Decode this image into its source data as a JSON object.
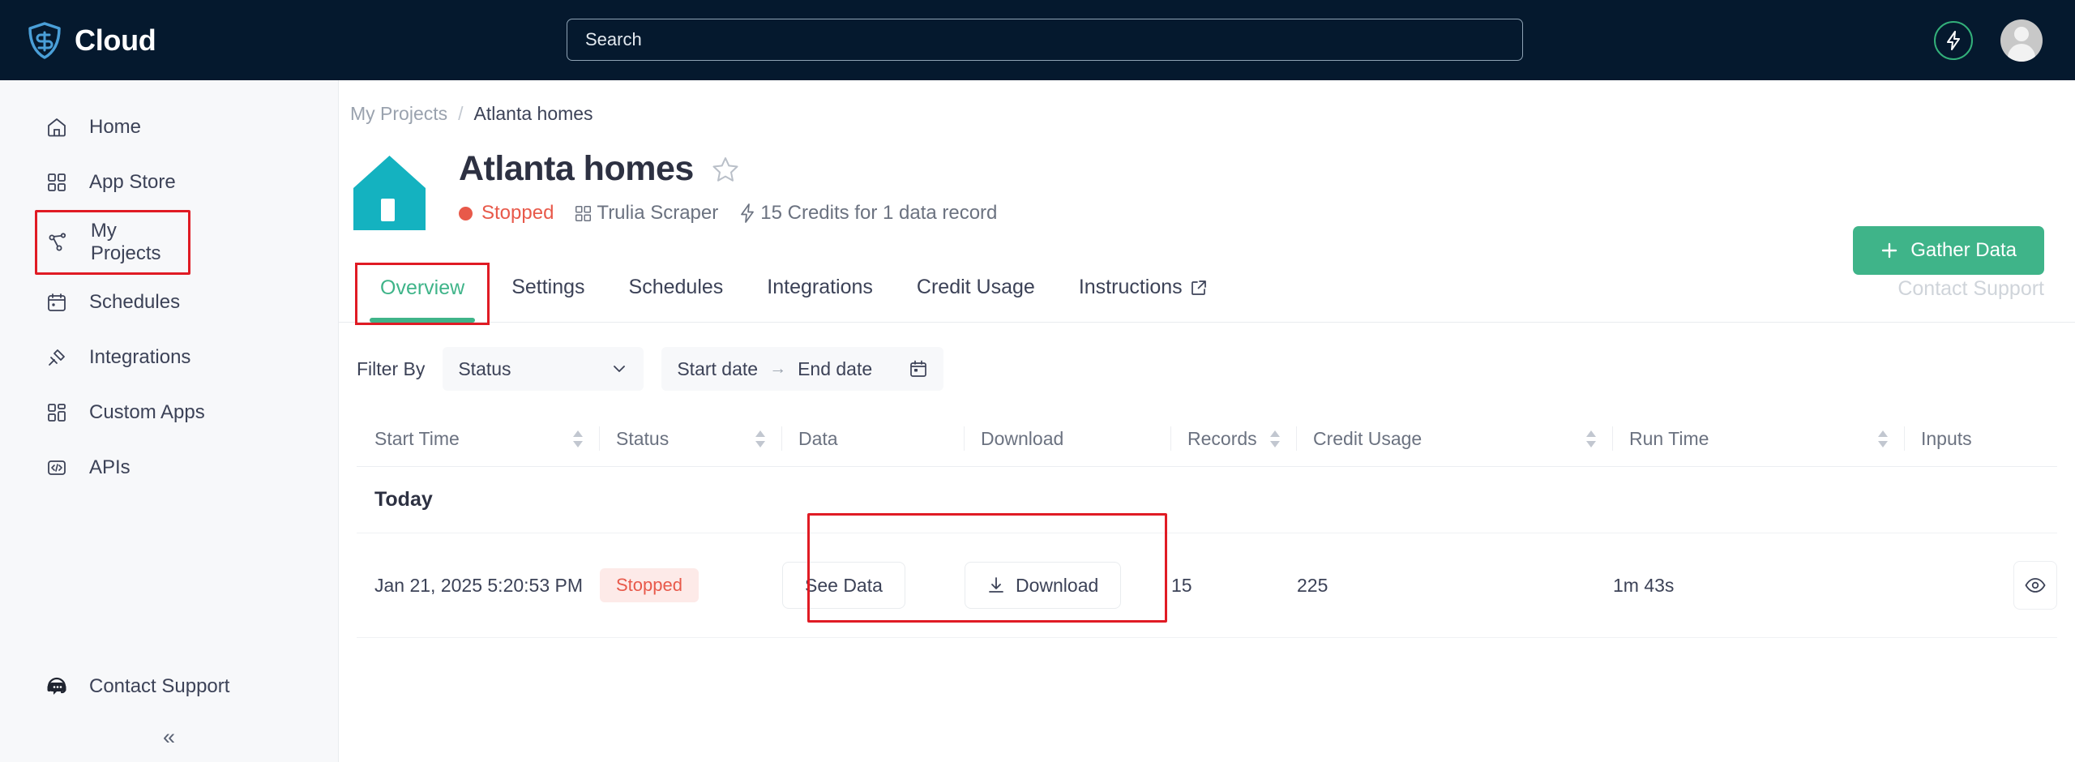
{
  "colors": {
    "topbar_bg": "#05192e",
    "accent_green": "#3fb489",
    "status_red": "#e8594a",
    "annotation_red": "#e01b24",
    "house_teal": "#14b2c0",
    "sidebar_bg": "#f7f8fa"
  },
  "topbar": {
    "brand_name": "Cloud",
    "logo_icon": "shield-logo-icon",
    "search_placeholder": "Search",
    "search_value": "",
    "credits_icon": "lightning-bolt-icon",
    "avatar_icon": "user-avatar-icon"
  },
  "sidebar": {
    "items": [
      {
        "label": "Home",
        "icon": "home-icon",
        "highlighted": false
      },
      {
        "label": "App Store",
        "icon": "grid-apps-icon",
        "highlighted": false
      },
      {
        "label": "My Projects",
        "icon": "project-nodes-icon",
        "highlighted": true
      },
      {
        "label": "Schedules",
        "icon": "calendar-icon",
        "highlighted": false
      },
      {
        "label": "Integrations",
        "icon": "plug-icon",
        "highlighted": false
      },
      {
        "label": "Custom Apps",
        "icon": "custom-grid-icon",
        "highlighted": false
      },
      {
        "label": "APIs",
        "icon": "code-brackets-icon",
        "highlighted": false
      }
    ],
    "support": {
      "label": "Contact Support",
      "icon": "headset-chat-icon"
    },
    "collapse_glyph": "«"
  },
  "breadcrumb": {
    "parent": "My Projects",
    "separator": "/",
    "current": "Atlanta homes"
  },
  "project": {
    "icon": "house-icon",
    "title": "Atlanta homes",
    "favorite_icon": "star-outline-icon",
    "status": "Stopped",
    "scraper_name": "Trulia Scraper",
    "scraper_icon": "grid-apps-icon",
    "credits_text": "15 Credits for 1 data record",
    "credits_icon": "lightning-bolt-icon"
  },
  "actions": {
    "gather_data_label": "Gather Data",
    "gather_data_icon": "plus-icon",
    "contact_support_label": "Contact Support"
  },
  "tabs": [
    {
      "label": "Overview",
      "active": true,
      "highlighted": true,
      "external": false
    },
    {
      "label": "Settings",
      "active": false,
      "highlighted": false,
      "external": false
    },
    {
      "label": "Schedules",
      "active": false,
      "highlighted": false,
      "external": false
    },
    {
      "label": "Integrations",
      "active": false,
      "highlighted": false,
      "external": false
    },
    {
      "label": "Credit Usage",
      "active": false,
      "highlighted": false,
      "external": false
    },
    {
      "label": "Instructions",
      "active": false,
      "highlighted": false,
      "external": true
    }
  ],
  "filters": {
    "filter_by_label": "Filter By",
    "status_select_value": "Status",
    "status_chevron_icon": "chevron-down-icon",
    "start_date_placeholder": "Start date",
    "date_range_arrow": "→",
    "end_date_placeholder": "End date",
    "calendar_icon": "calendar-icon"
  },
  "table": {
    "columns": [
      {
        "label": "Start Time",
        "sortable": true
      },
      {
        "label": "Status",
        "sortable": true
      },
      {
        "label": "Data",
        "sortable": false
      },
      {
        "label": "Download",
        "sortable": false
      },
      {
        "label": "Records",
        "sortable": true
      },
      {
        "label": "Credit Usage",
        "sortable": true
      },
      {
        "label": "Run Time",
        "sortable": true
      },
      {
        "label": "Inputs",
        "sortable": false
      }
    ],
    "groups": [
      {
        "label": "Today",
        "rows": [
          {
            "start_time": "Jan 21, 2025 5:20:53 PM",
            "status": "Stopped",
            "see_data_label": "See Data",
            "download_label": "Download",
            "download_icon": "download-icon",
            "records": "15",
            "credit_usage": "225",
            "run_time": "1m 43s",
            "inputs_icon": "eye-icon"
          }
        ]
      }
    ]
  }
}
